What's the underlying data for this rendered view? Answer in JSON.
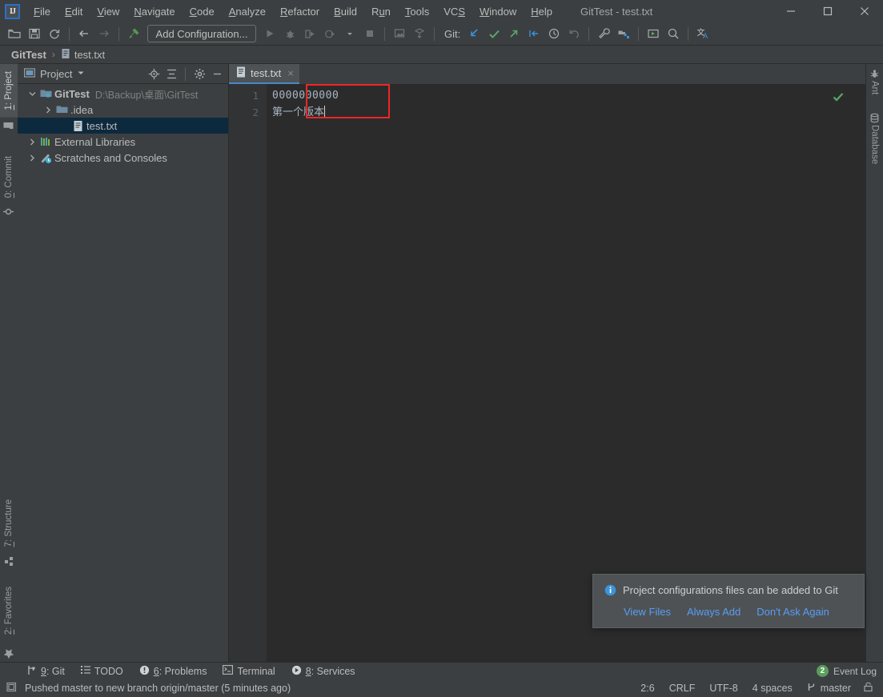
{
  "window": {
    "title": "GitTest - test.txt",
    "logo_text": "IJ",
    "controls": [
      {
        "name": "minimize",
        "glyph": "minimize-icon"
      },
      {
        "name": "maximize",
        "glyph": "maximize-icon"
      },
      {
        "name": "close",
        "glyph": "close-icon"
      }
    ]
  },
  "menubar": {
    "items": [
      {
        "label": "File",
        "mnemonic": "F"
      },
      {
        "label": "Edit",
        "mnemonic": "E"
      },
      {
        "label": "View",
        "mnemonic": "V"
      },
      {
        "label": "Navigate",
        "mnemonic": "N"
      },
      {
        "label": "Code",
        "mnemonic": "C"
      },
      {
        "label": "Analyze",
        "mnemonic": "A"
      },
      {
        "label": "Refactor",
        "mnemonic": "R"
      },
      {
        "label": "Build",
        "mnemonic": "B"
      },
      {
        "label": "Run",
        "mnemonic": "u"
      },
      {
        "label": "Tools",
        "mnemonic": "T"
      },
      {
        "label": "VCS",
        "mnemonic": "S"
      },
      {
        "label": "Window",
        "mnemonic": "W"
      },
      {
        "label": "Help",
        "mnemonic": "H"
      }
    ]
  },
  "toolbar": {
    "run_config_label": "Add Configuration...",
    "git_label": "Git:",
    "icons": [
      "open-folder-icon",
      "save-all-icon",
      "sync-refresh-icon",
      "back-arrow-icon",
      "forward-arrow-icon",
      "build-hammer-icon",
      "run-icon",
      "debug-icon",
      "run-with-coverage-icon",
      "profile-icon",
      "stop-icon",
      "select-opened-file-icon",
      "structure-icon",
      "git-update-icon",
      "git-commit-icon",
      "git-push-icon",
      "git-branches-icon",
      "git-history-icon",
      "git-rollback-icon",
      "settings-wrench-icon",
      "project-structure-icon",
      "run-anything-icon",
      "search-everywhere-icon",
      "translate-icon"
    ]
  },
  "breadcrumb": {
    "project": "GitTest",
    "separator": "›",
    "file": "test.txt"
  },
  "left_stripe": {
    "top": [
      {
        "label": "1: Project",
        "mnemonic": "1",
        "active": true,
        "icon": "project-folder-icon"
      },
      {
        "label": "0: Commit",
        "mnemonic": "0",
        "active": false,
        "icon": "commit-icon"
      }
    ],
    "bottom": [
      {
        "label": "7: Structure",
        "mnemonic": "7",
        "active": false,
        "icon": "structure-squares-icon"
      },
      {
        "label": "2: Favorites",
        "mnemonic": "2",
        "active": false,
        "icon": "star-icon"
      }
    ]
  },
  "right_stripe": {
    "top": [
      {
        "label": "Ant",
        "icon": "ant-icon"
      },
      {
        "label": "Database",
        "icon": "database-icon"
      }
    ]
  },
  "project_panel": {
    "title": "Project",
    "dropdown_icon": "chevron-down-icon",
    "actions": [
      "locate-target-icon",
      "collapse-all-icon",
      "settings-gear-icon",
      "hide-minimize-icon"
    ],
    "tree": [
      {
        "label": "GitTest",
        "path": "D:\\Backup\\桌面\\GitTest",
        "depth": 0,
        "arrow": "expanded",
        "icon": "module-folder-icon",
        "bold": true,
        "selected": false
      },
      {
        "label": ".idea",
        "path": "",
        "depth": 1,
        "arrow": "collapsed",
        "icon": "folder-icon",
        "bold": false,
        "selected": false
      },
      {
        "label": "test.txt",
        "path": "",
        "depth": 2,
        "arrow": "none",
        "icon": "text-file-icon",
        "bold": false,
        "selected": true
      },
      {
        "label": "External Libraries",
        "path": "",
        "depth": 0,
        "arrow": "collapsed",
        "icon": "libraries-icon",
        "bold": false,
        "selected": false
      },
      {
        "label": "Scratches and Consoles",
        "path": "",
        "depth": 0,
        "arrow": "collapsed",
        "icon": "scratches-icon",
        "bold": false,
        "selected": false
      }
    ]
  },
  "editor": {
    "tab": {
      "label": "test.txt",
      "icon": "text-file-icon",
      "close_glyph": "×"
    },
    "line_numbers": [
      "1",
      "2"
    ],
    "lines": [
      "0000000000",
      "第一个版本"
    ],
    "inspection_status": "ok-check-icon",
    "highlight_box_color": "#ef2626"
  },
  "notification": {
    "icon": "info-icon",
    "message": "Project configurations files can be added to Git",
    "links": [
      "View Files",
      "Always Add",
      "Don't Ask Again"
    ]
  },
  "bottom_bar": {
    "tabs": [
      {
        "label": "9: Git",
        "mnemonic": "9",
        "icon": "git-branch-icon"
      },
      {
        "label": "TODO",
        "mnemonic": "",
        "icon": "todo-list-icon"
      },
      {
        "label": "6: Problems",
        "mnemonic": "6",
        "icon": "problems-icon"
      },
      {
        "label": "Terminal",
        "mnemonic": "",
        "icon": "terminal-icon"
      },
      {
        "label": "8: Services",
        "mnemonic": "8",
        "icon": "services-icon"
      }
    ],
    "event_log": {
      "label": "Event Log",
      "count": "2",
      "badge_color": "#5a9e5a"
    }
  },
  "status_bar": {
    "message": "Pushed master to new branch origin/master (5 minutes ago)",
    "message_icon": "toggle-widgets-icon",
    "caret_position": "2:6",
    "line_separator": "CRLF",
    "encoding": "UTF-8",
    "indent": "4 spaces",
    "branch": "master",
    "branch_icon": "git-branch-icon",
    "lock_icon": "lock-icon"
  }
}
